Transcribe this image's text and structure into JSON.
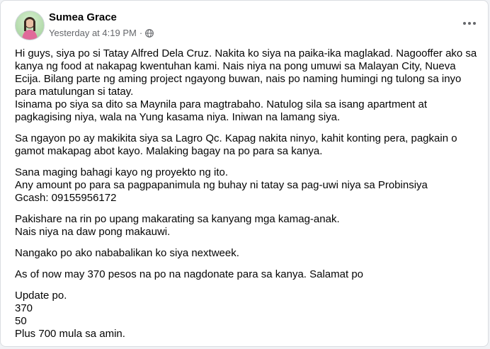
{
  "post": {
    "author": "Sumea Grace",
    "timestamp": "Yesterday at 4:19 PM",
    "separator": "·",
    "privacy_icon": "globe-icon",
    "more_icon": "more-horizontal-icon"
  },
  "body": {
    "p1": [
      "Hi guys, siya po si Tatay Alfred Dela Cruz.  Nakita ko siya na paika-ika maglakad. Nagooffer ako sa",
      "kanya ng food at nakapag kwentuhan  kami. Nais niya na pong umuwi sa Malayan City, Nueva",
      "Ecija. Bilang parte ng aming project ngayong buwan, nais po naming humingi ng tulong sa inyo",
      "para matulungan si tatay.",
      "Isinama po siya sa dito sa Maynila para magtrabaho. Natulog sila sa isang apartment at",
      "pagkagising niya, wala na Yung kasama niya. Iniwan na lamang siya."
    ],
    "p2": [
      "Sa ngayon po ay makikita siya sa Lagro Qc. Kapag nakita ninyo, kahit konting pera, pagkain o",
      "gamot makapag abot kayo. Malaking bagay na po para sa kanya."
    ],
    "p3": [
      "Sana maging bahagi kayo ng proyekto ng ito.",
      "Any amount po para sa pagpapanimula ng buhay ni tatay sa pag-uwi niya sa Probinsiya",
      "Gcash: 09155956172"
    ],
    "p4": [
      "Pakishare na rin po upang makarating sa kanyang mga kamag-anak.",
      "Nais niya na daw pong makauwi."
    ],
    "p5": [
      "Nangako po ako nababalikan ko siya nextweek."
    ],
    "p6": [
      "As of now may 370 pesos na po na nagdonate para sa kanya. Salamat po"
    ],
    "p7": [
      "Update po.",
      "370",
      "50",
      "Plus 700 mula sa amin."
    ]
  }
}
